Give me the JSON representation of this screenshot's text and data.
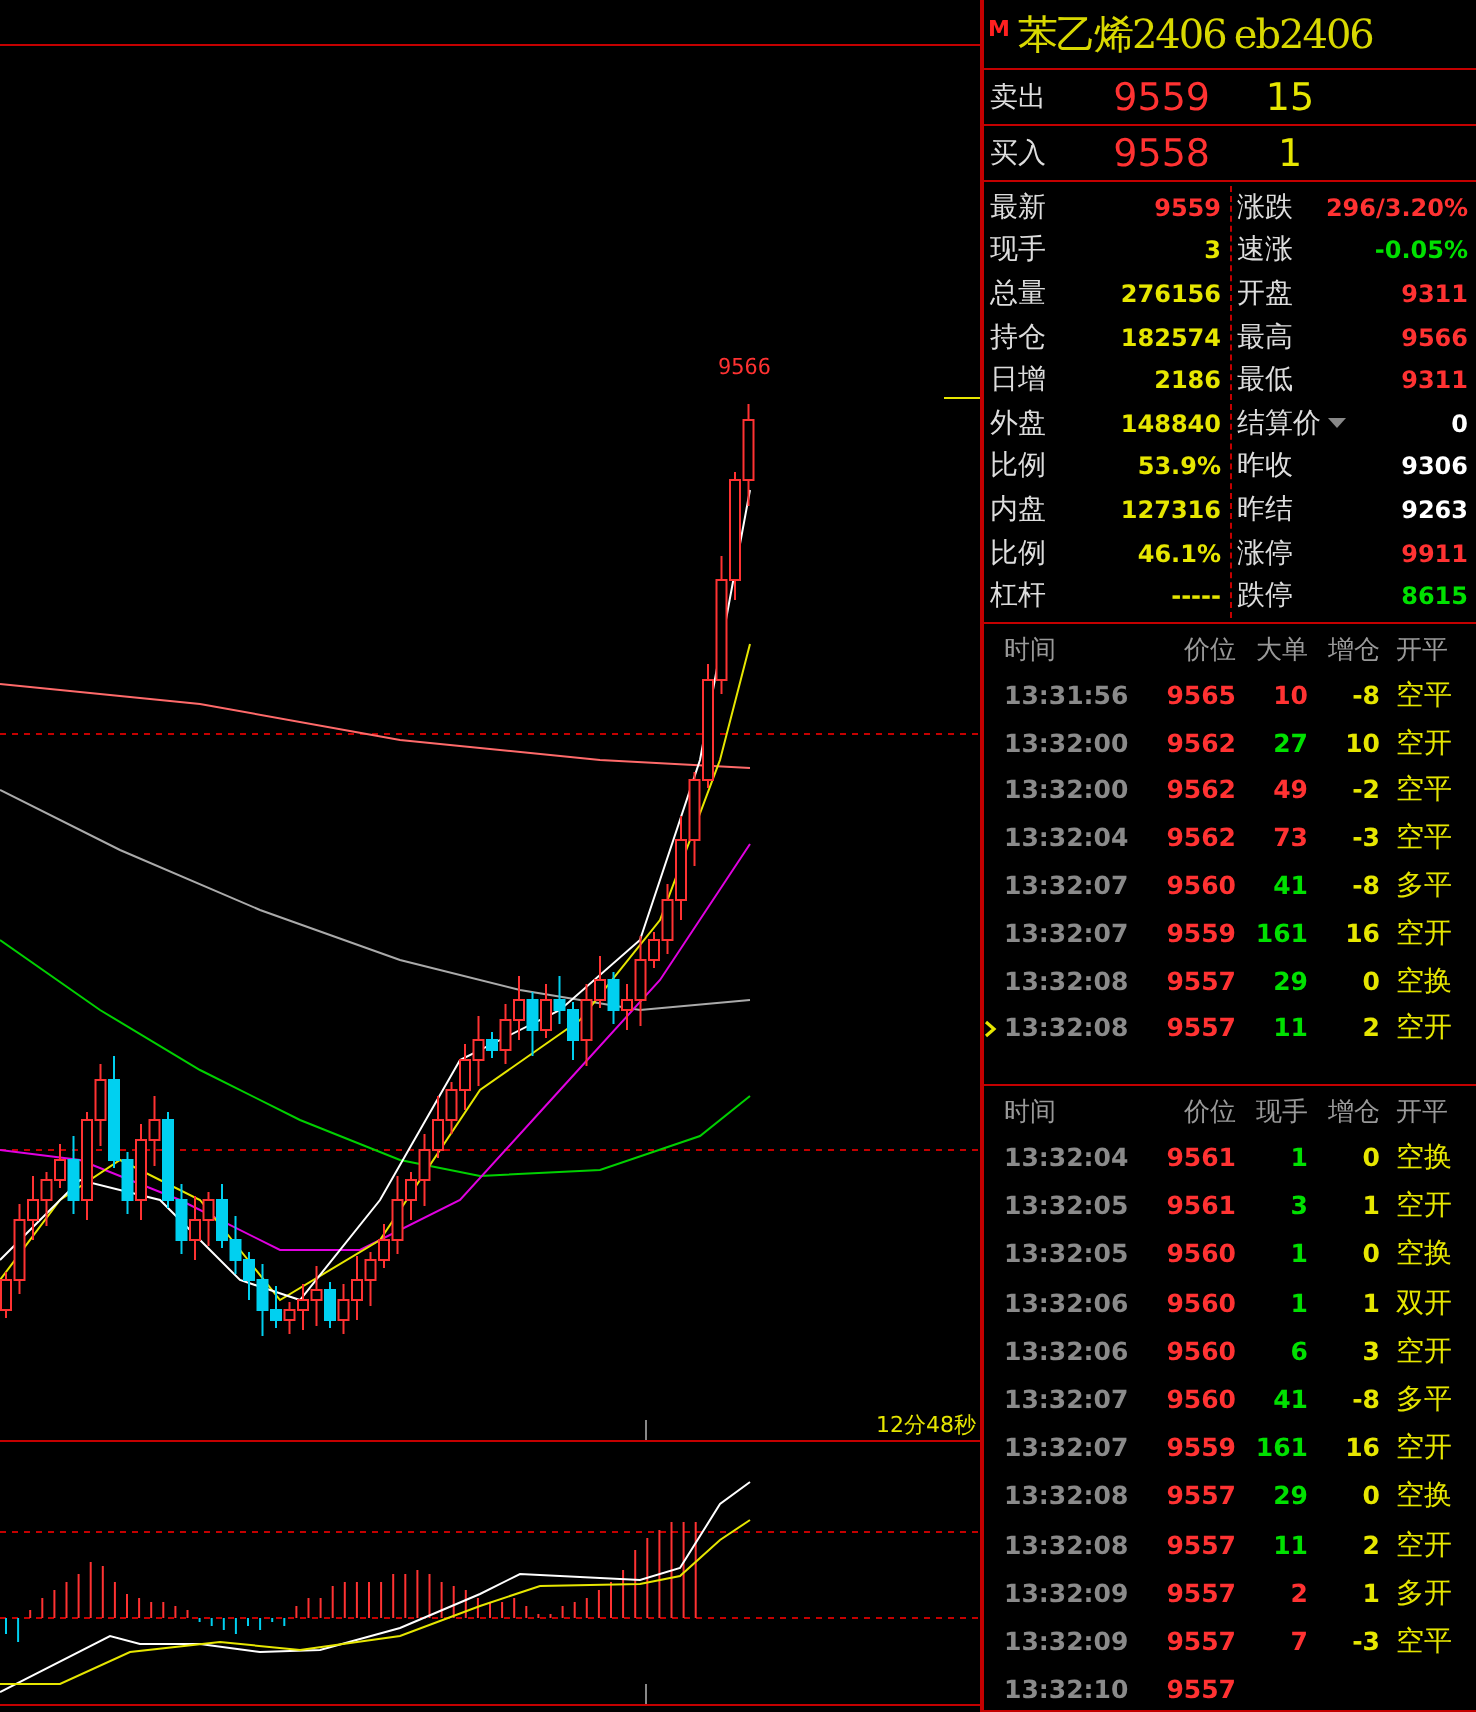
{
  "contract": {
    "badge": "M",
    "name": "苯乙烯2406",
    "code": "eb2406"
  },
  "quotes": [
    {
      "label": "卖出",
      "price": "9559",
      "volume": "15"
    },
    {
      "label": "买入",
      "price": "9558",
      "volume": "1"
    }
  ],
  "stats_left": [
    {
      "label": "最新",
      "value": "9559",
      "color": "#ff3232"
    },
    {
      "label": "现手",
      "value": "3",
      "color": "#e6e600"
    },
    {
      "label": "总量",
      "value": "276156",
      "color": "#e6e600"
    },
    {
      "label": "持仓",
      "value": "182574",
      "color": "#e6e600"
    },
    {
      "label": "日增",
      "value": "2186",
      "color": "#e6e600"
    },
    {
      "label": "外盘",
      "value": "148840",
      "color": "#e6e600"
    },
    {
      "label": "比例",
      "value": "53.9%",
      "color": "#e6e600"
    },
    {
      "label": "内盘",
      "value": "127316",
      "color": "#e6e600"
    },
    {
      "label": "比例",
      "value": "46.1%",
      "color": "#e6e600"
    },
    {
      "label": "杠杆",
      "value": "-----",
      "color": "#e6e600"
    }
  ],
  "stats_right": [
    {
      "label": "涨跌",
      "value": "296/3.20%",
      "color": "#ff3232",
      "dropdown": false
    },
    {
      "label": "速涨",
      "value": "-0.05%",
      "color": "#00e000",
      "dropdown": false
    },
    {
      "label": "开盘",
      "value": "9311",
      "color": "#ff3232",
      "dropdown": false
    },
    {
      "label": "最高",
      "value": "9566",
      "color": "#ff3232",
      "dropdown": false
    },
    {
      "label": "最低",
      "value": "9311",
      "color": "#ff3232",
      "dropdown": false
    },
    {
      "label": "结算价",
      "value": "0",
      "color": "#ffffff",
      "dropdown": true
    },
    {
      "label": "昨收",
      "value": "9306",
      "color": "#ffffff",
      "dropdown": false
    },
    {
      "label": "昨结",
      "value": "9263",
      "color": "#ffffff",
      "dropdown": false
    },
    {
      "label": "涨停",
      "value": "9911",
      "color": "#ff3232",
      "dropdown": false
    },
    {
      "label": "跌停",
      "value": "8615",
      "color": "#00e000",
      "dropdown": false
    }
  ],
  "chart": {
    "high_label": "9566",
    "timer": "12分48秒"
  },
  "big_orders": {
    "columns": [
      "时间",
      "价位",
      "大单",
      "增仓",
      "开平"
    ],
    "rows": [
      {
        "time": "13:31:56",
        "price": "9565",
        "volume": "10",
        "color": "#ff3232",
        "change": "-8",
        "action": "空平",
        "selected": false
      },
      {
        "time": "13:32:00",
        "price": "9562",
        "volume": "27",
        "color": "#00e000",
        "change": "10",
        "action": "空开",
        "selected": false
      },
      {
        "time": "13:32:00",
        "price": "9562",
        "volume": "49",
        "color": "#ff3232",
        "change": "-2",
        "action": "空平",
        "selected": false
      },
      {
        "time": "13:32:04",
        "price": "9562",
        "volume": "73",
        "color": "#ff3232",
        "change": "-3",
        "action": "空平",
        "selected": false
      },
      {
        "time": "13:32:07",
        "price": "9560",
        "volume": "41",
        "color": "#00e000",
        "change": "-8",
        "action": "多平",
        "selected": false
      },
      {
        "time": "13:32:07",
        "price": "9559",
        "volume": "161",
        "color": "#00e000",
        "change": "16",
        "action": "空开",
        "selected": false
      },
      {
        "time": "13:32:08",
        "price": "9557",
        "volume": "29",
        "color": "#00e000",
        "change": "0",
        "action": "空换",
        "selected": false
      },
      {
        "time": "13:32:08",
        "price": "9557",
        "volume": "11",
        "color": "#00e000",
        "change": "2",
        "action": "空开",
        "selected": true
      }
    ]
  },
  "ticks": {
    "columns": [
      "时间",
      "价位",
      "现手",
      "增仓",
      "开平"
    ],
    "rows": [
      {
        "time": "13:32:04",
        "price": "9561",
        "volume": "1",
        "color": "#00e000",
        "change": "0",
        "action": "空换"
      },
      {
        "time": "13:32:05",
        "price": "9561",
        "volume": "3",
        "color": "#00e000",
        "change": "1",
        "action": "空开"
      },
      {
        "time": "13:32:05",
        "price": "9560",
        "volume": "1",
        "color": "#00e000",
        "change": "0",
        "action": "空换"
      },
      {
        "time": "13:32:06",
        "price": "9560",
        "volume": "1",
        "color": "#00e000",
        "change": "1",
        "action": "双开"
      },
      {
        "time": "13:32:06",
        "price": "9560",
        "volume": "6",
        "color": "#00e000",
        "change": "3",
        "action": "空开"
      },
      {
        "time": "13:32:07",
        "price": "9560",
        "volume": "41",
        "color": "#00e000",
        "change": "-8",
        "action": "多平"
      },
      {
        "time": "13:32:07",
        "price": "9559",
        "volume": "161",
        "color": "#00e000",
        "change": "16",
        "action": "空开"
      },
      {
        "time": "13:32:08",
        "price": "9557",
        "volume": "29",
        "color": "#00e000",
        "change": "0",
        "action": "空换"
      },
      {
        "time": "13:32:08",
        "price": "9557",
        "volume": "11",
        "color": "#00e000",
        "change": "2",
        "action": "空开"
      },
      {
        "time": "13:32:09",
        "price": "9557",
        "volume": "2",
        "color": "#ff3232",
        "change": "1",
        "action": "多开"
      },
      {
        "time": "13:32:09",
        "price": "9557",
        "volume": "7",
        "color": "#ff3232",
        "change": "-3",
        "action": "空平"
      },
      {
        "time": "13:32:10",
        "price": "9557"
      }
    ]
  }
}
